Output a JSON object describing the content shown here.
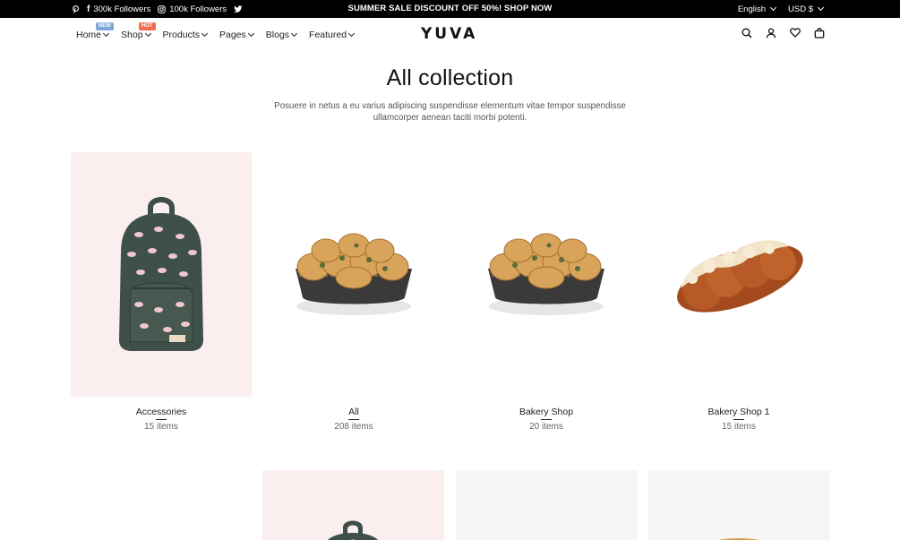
{
  "topbar": {
    "facebook_followers": "300k Followers",
    "instagram_followers": "100k Followers",
    "promo": "SUMMER SALE DISCOUNT OFF 50%! SHOP NOW",
    "language": "English",
    "currency": "USD $"
  },
  "nav": {
    "items": [
      {
        "label": "Home",
        "badge": "NEW"
      },
      {
        "label": "Shop",
        "badge": "HOT"
      },
      {
        "label": "Products",
        "badge": ""
      },
      {
        "label": "Pages",
        "badge": ""
      },
      {
        "label": "Blogs",
        "badge": ""
      },
      {
        "label": "Featured",
        "badge": ""
      }
    ],
    "logo": "YUVA"
  },
  "page": {
    "title": "All collection",
    "description": "Posuere in netus a eu varius adipiscing suspendisse elementum vitae tempor suspendisse ullamcorper aenean taciti morbi potenti."
  },
  "collections": [
    {
      "name": "Accessories",
      "count": "15 items",
      "image": "backpack"
    },
    {
      "name": "All",
      "count": "208 items",
      "image": "bread-round"
    },
    {
      "name": "Bakery Shop",
      "count": "20 items",
      "image": "bread-round"
    },
    {
      "name": "Bakery Shop 1",
      "count": "15 items",
      "image": "bread-braided"
    }
  ],
  "colors": {
    "topbar_bg": "#000000",
    "badge_new": "#7ea7d8",
    "badge_hot": "#f06e4f",
    "accessory_bg": "#fbeeee",
    "placeholder_bg": "#f6f6f6"
  }
}
